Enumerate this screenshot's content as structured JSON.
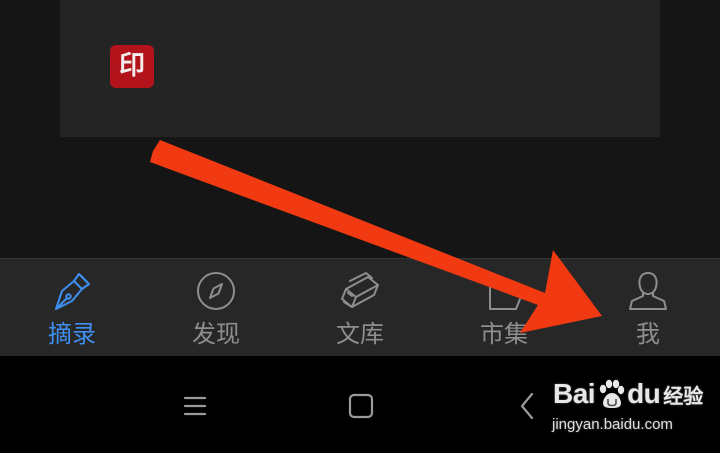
{
  "content": {
    "seal_char": "印",
    "seal_color": "#b3141c"
  },
  "tabbar": {
    "active_color": "#3f8ff0",
    "inactive_color": "#8e8e8e",
    "tabs": [
      {
        "label": "摘录",
        "icon": "fountain-pen-icon",
        "active": true
      },
      {
        "label": "发现",
        "icon": "compass-icon",
        "active": false
      },
      {
        "label": "文库",
        "icon": "books-icon",
        "active": false
      },
      {
        "label": "市集",
        "icon": "market-icon",
        "active": false
      },
      {
        "label": "我",
        "icon": "person-icon",
        "active": false
      }
    ]
  },
  "system_nav": {
    "buttons": [
      {
        "icon": "menu-icon"
      },
      {
        "icon": "home-square-icon"
      },
      {
        "icon": "back-chevron-icon"
      }
    ]
  },
  "annotation": {
    "arrow_color": "#f23a12"
  },
  "watermark": {
    "brand_left": "Bai",
    "brand_right": "du",
    "product": "经验",
    "url": "jingyan.baidu.com"
  }
}
